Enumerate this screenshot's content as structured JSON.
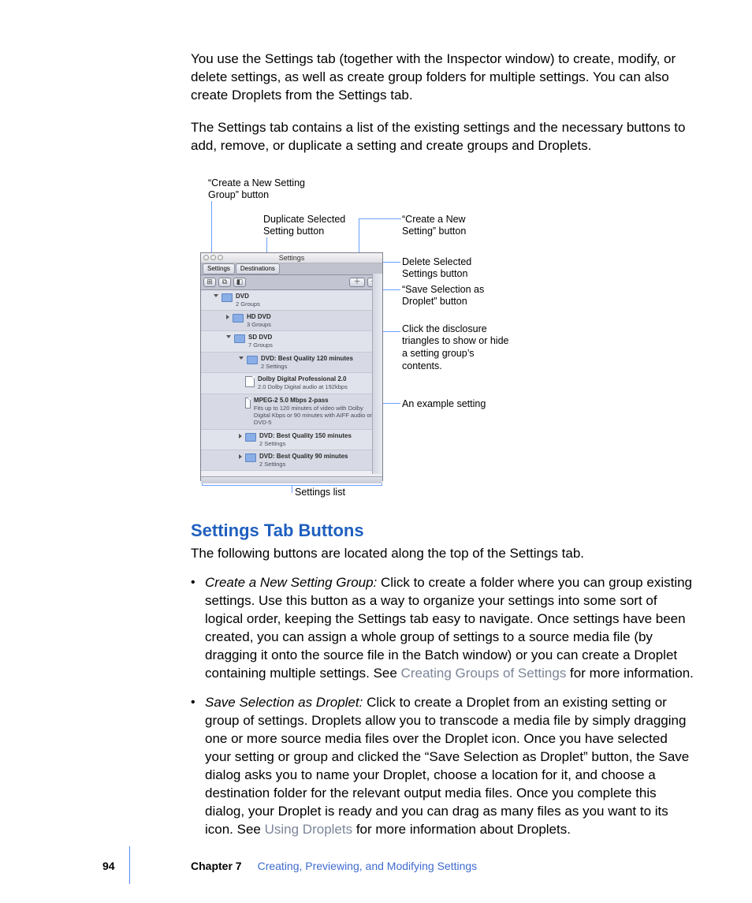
{
  "paragraphs": {
    "intro1": "You use the Settings tab (together with the Inspector window) to create, modify, or delete settings, as well as create group folders for multiple settings. You can also create Droplets from the Settings tab.",
    "intro2": "The Settings tab contains a list of the existing settings and the necessary buttons to add, remove, or duplicate a setting and create groups and Droplets."
  },
  "callouts": {
    "new_group": "“Create a New Setting Group” button",
    "duplicate": "Duplicate Selected Setting button",
    "new_setting": "“Create a New Setting” button",
    "delete": "Delete Selected Settings button",
    "save_droplet": "“Save Selection as Droplet” button",
    "disclosure": "Click the disclosure triangles to show or hide a setting group’s contents.",
    "example": "An example setting",
    "settings_list": "Settings list"
  },
  "screenshot": {
    "title": "Settings",
    "tabs": {
      "settings": "Settings",
      "destinations": "Destinations"
    },
    "rows": {
      "dvd": {
        "t1": "DVD",
        "t2": "2 Groups"
      },
      "hddvd": {
        "t1": "HD DVD",
        "t2": "3 Groups"
      },
      "sddvd": {
        "t1": "SD DVD",
        "t2": "7 Groups"
      },
      "bq120": {
        "t1": "DVD: Best Quality 120 minutes",
        "t2": "2 Settings"
      },
      "dolby": {
        "t1": "Dolby Digital Professional 2.0",
        "t2": "2.0 Dolby Digital audio at 192kbps"
      },
      "mpeg": {
        "t1": "MPEG-2 5.0 Mbps 2-pass",
        "t2": "Fits up to 120 minutes of video with Dolby Digital Kbps or 90 minutes with AIFF audio on a DVD-5"
      },
      "bq150": {
        "t1": "DVD: Best Quality 150 minutes",
        "t2": "2 Settings"
      },
      "bq90": {
        "t1": "DVD: Best Quality 90 minutes",
        "t2": "2 Settings"
      }
    }
  },
  "section": {
    "heading": "Settings Tab Buttons",
    "intro": "The following buttons are located along the top of the Settings tab.",
    "item1_term": "Create a New Setting Group: ",
    "item1_body_a": " Click to create a folder where you can group existing settings. Use this button as a way to organize your settings into some sort of logical order, keeping the Settings tab easy to navigate. Once settings have been created, you can assign a whole group of settings to a source media file (by dragging it onto the source file in the Batch window) or you can create a Droplet containing multiple settings. See ",
    "item1_link": "Creating Groups of Settings",
    "item1_body_b": " for more information.",
    "item2_term": "Save Selection as Droplet: ",
    "item2_body_a": " Click to create a Droplet from an existing setting or group of settings. Droplets allow you to transcode a media file by simply dragging one or more source media files over the Droplet icon. Once you have selected your setting or group and clicked the “Save Selection as Droplet” button, the Save dialog asks you to name your Droplet, choose a location for it, and choose a destination folder for the relevant output media files. Once you complete this dialog, your Droplet is ready and you can drag as many files as you want to its icon. See ",
    "item2_link": "Using Droplets",
    "item2_body_b": " for more information about Droplets."
  },
  "footer": {
    "page": "94",
    "chapter_label": "Chapter 7",
    "chapter_title": "Creating, Previewing, and Modifying Settings"
  }
}
